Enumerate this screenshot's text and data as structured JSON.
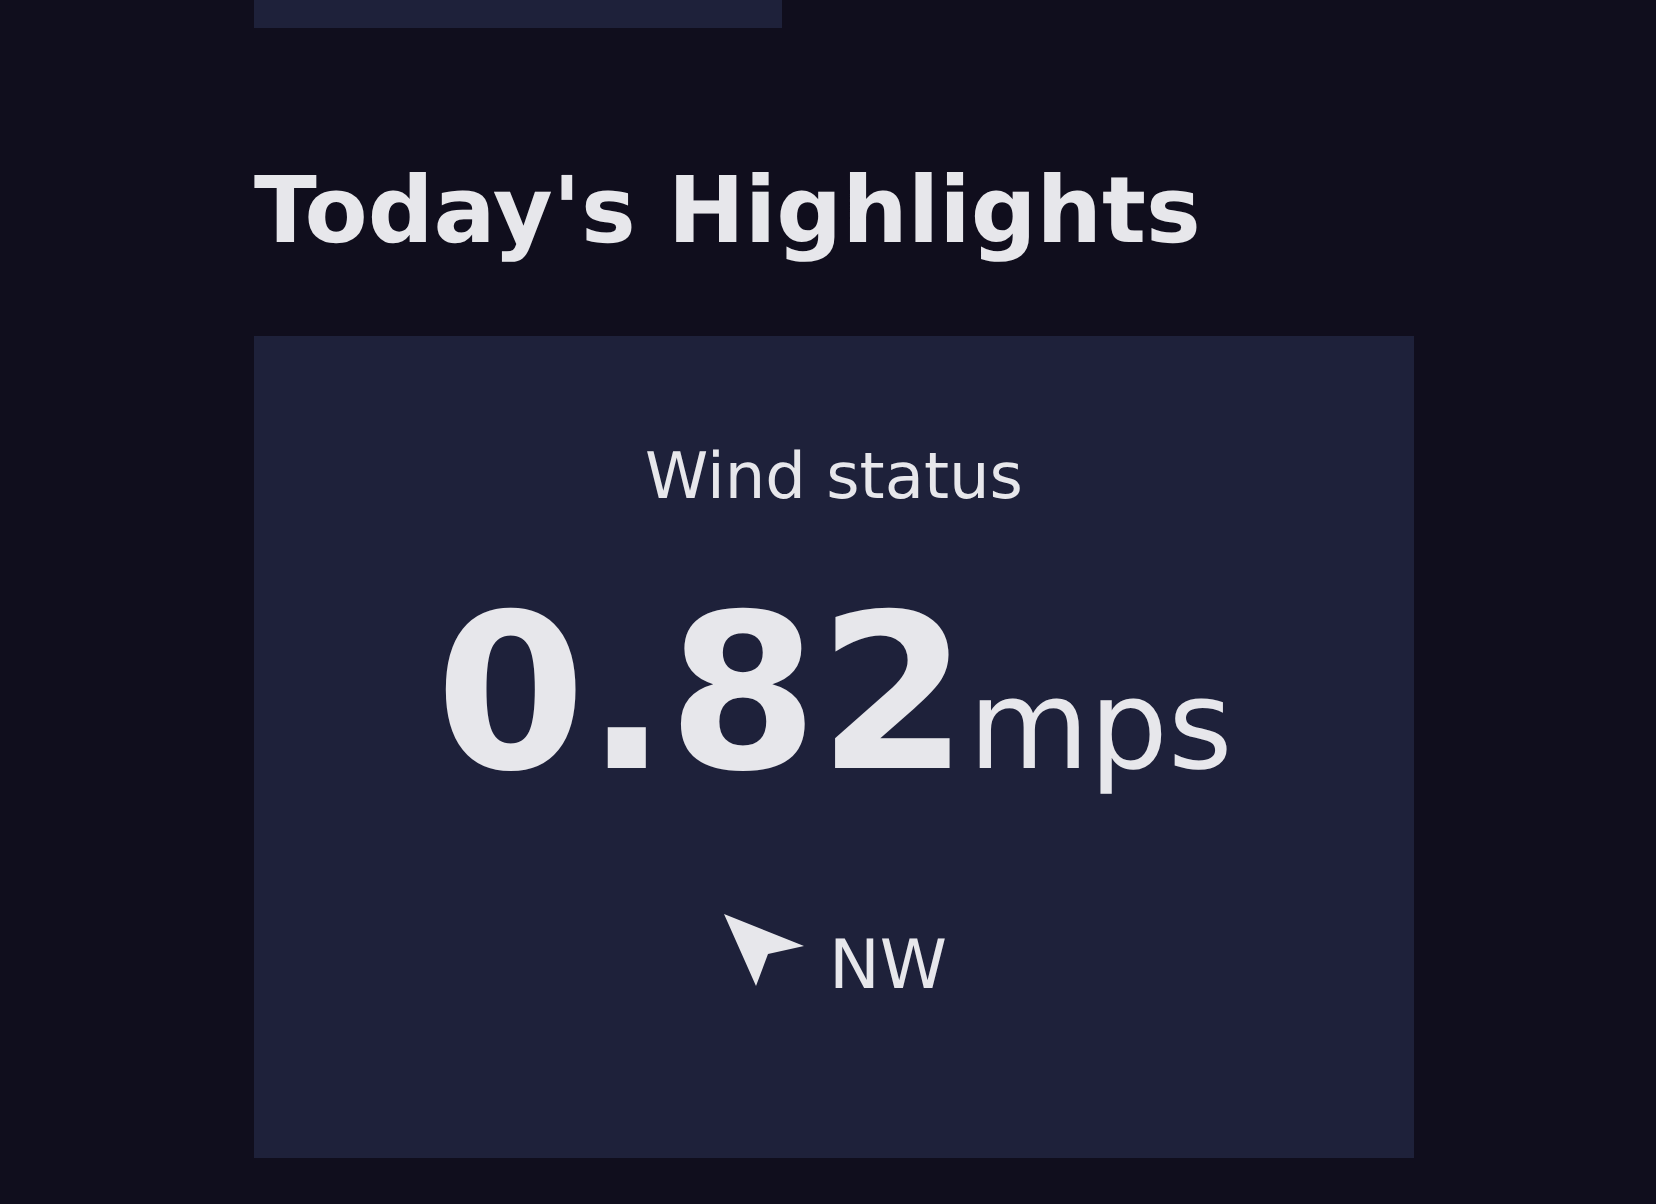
{
  "heading": "Today's Highlights",
  "card": {
    "title": "Wind status",
    "value": "0.82",
    "unit": "mps",
    "direction": "NW"
  }
}
